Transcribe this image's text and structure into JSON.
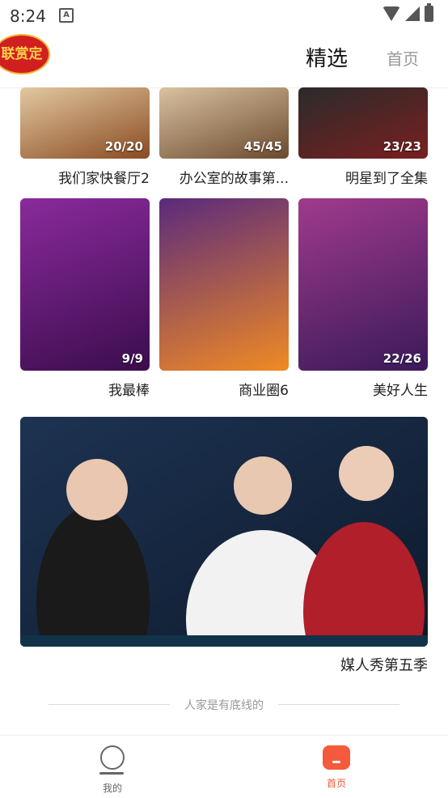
{
  "status": {
    "time": "8:24"
  },
  "header": {
    "logo_text": "联赏定",
    "tab_selected": "精选",
    "tab_home": "首页"
  },
  "cards": [
    {
      "title": "我们家快餐厅2",
      "badge": "20/20",
      "color": "#c0793a"
    },
    {
      "title": "办公室的故事第...",
      "badge": "45/45",
      "color": "#b68a5c"
    },
    {
      "title": "明星到了全集",
      "badge": "23/23",
      "color": "#3a2a2a"
    },
    {
      "title": "我最棒",
      "badge": "9/9",
      "color": "#6c2a7a"
    },
    {
      "title": "商业圈6",
      "badge": "",
      "color": "#d07a24"
    },
    {
      "title": "美好人生",
      "badge": "22/26",
      "color": "#7a2a6a"
    }
  ],
  "banner": {
    "title": "媒人秀第五季"
  },
  "divider_text": "人家是有底线的",
  "bottom_nav": {
    "mine_label": "我的",
    "home_label": "首页",
    "active_color": "#f55a3c"
  }
}
